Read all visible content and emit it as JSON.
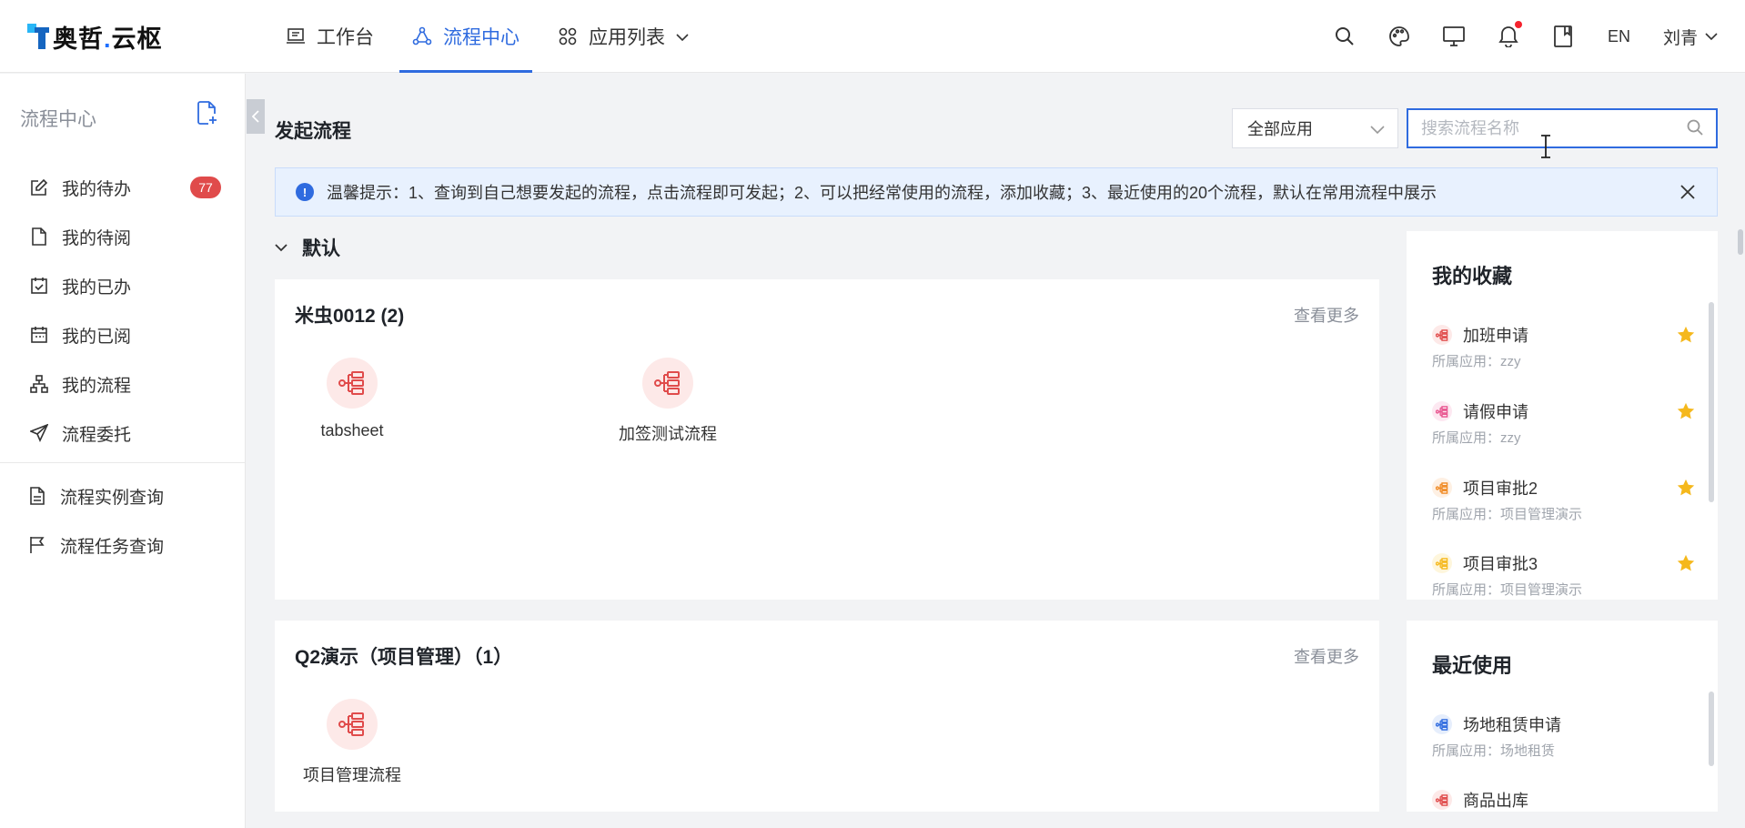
{
  "brand": {
    "name": "奥哲",
    "dot": ".",
    "suffix": "云枢"
  },
  "nav": {
    "items": [
      {
        "label": "工作台"
      },
      {
        "label": "流程中心"
      },
      {
        "label": "应用列表"
      }
    ]
  },
  "topbar": {
    "lang": "EN",
    "user": "刘青"
  },
  "sidebar": {
    "title": "流程中心",
    "items": [
      {
        "label": "我的待办",
        "badge": "77"
      },
      {
        "label": "我的待阅"
      },
      {
        "label": "我的已办"
      },
      {
        "label": "我的已阅"
      },
      {
        "label": "我的流程"
      },
      {
        "label": "流程委托"
      }
    ],
    "items2": [
      {
        "label": "流程实例查询"
      },
      {
        "label": "流程任务查询"
      }
    ]
  },
  "main": {
    "title": "发起流程",
    "app_filter": "全部应用",
    "search_placeholder": "搜索流程名称",
    "tip": "温馨提示：1、查询到自己想要发起的流程，点击流程即可发起；2、可以把经常使用的流程，添加收藏；3、最近使用的20个流程，默认在常用流程中展示",
    "group": "默认",
    "more_label": "查看更多",
    "cards": [
      {
        "title": "米虫0012 (2)",
        "processes": [
          "tabsheet",
          "加签测试流程"
        ]
      },
      {
        "title": "Q2演示（项目管理）（1）",
        "processes": [
          "项目管理流程"
        ]
      }
    ]
  },
  "favorites": {
    "title": "我的收藏",
    "items": [
      {
        "name": "加班申请",
        "app": "所属应用：zzy",
        "color": "#e04b4b"
      },
      {
        "name": "请假申请",
        "app": "所属应用：zzy",
        "color": "#e8548f"
      },
      {
        "name": "项目审批2",
        "app": "所属应用：项目管理演示",
        "color": "#f08a24"
      },
      {
        "name": "项目审批3",
        "app": "所属应用：项目管理演示",
        "color": "#f5b81c"
      }
    ]
  },
  "recent": {
    "title": "最近使用",
    "items": [
      {
        "name": "场地租赁申请",
        "app": "所属应用：场地租赁",
        "color": "#2f6bdf"
      },
      {
        "name": "商品出库",
        "app": "",
        "color": "#e04b4b"
      }
    ]
  },
  "colors": {
    "accent": "#2f6bdf",
    "badge": "#e04b4b",
    "star": "#f5b81c"
  }
}
